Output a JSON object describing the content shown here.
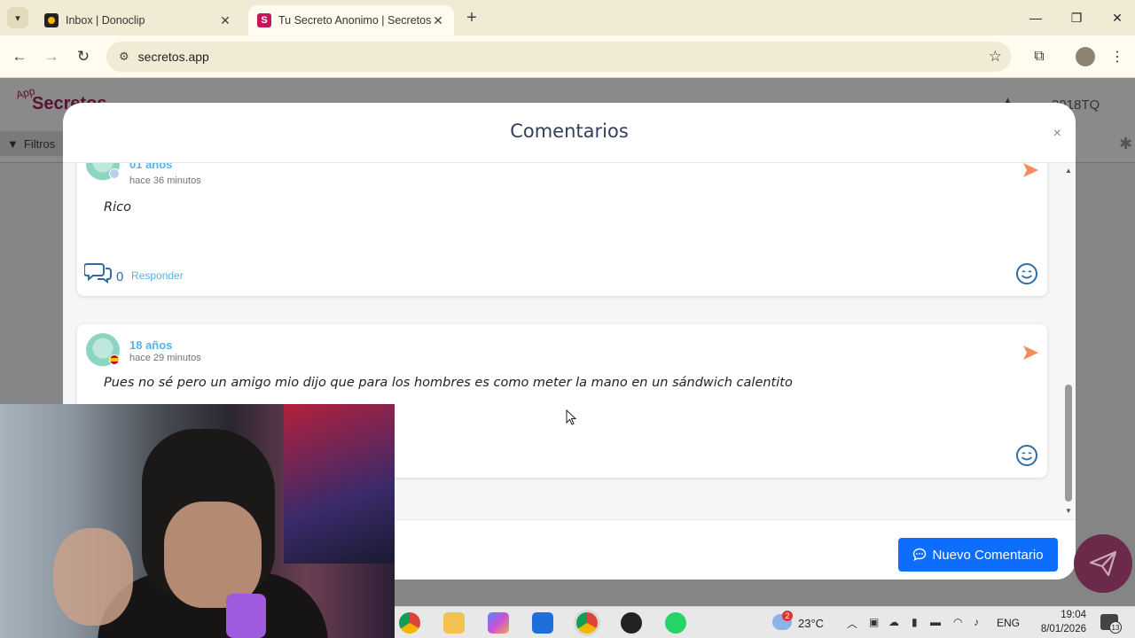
{
  "browser": {
    "tabs": [
      {
        "title": "Inbox | Donoclip",
        "active": false
      },
      {
        "title": "Tu Secreto Anonimo | Secretos",
        "active": true
      }
    ],
    "url": "secretos.app"
  },
  "page": {
    "logo_small": "App",
    "logo": "Secretos",
    "filters_label": "Filtros",
    "user_code": "3918TQ"
  },
  "modal": {
    "title": "Comentarios",
    "close_label": "×",
    "comments": [
      {
        "age": "01 años",
        "time": "hace 36 minutos",
        "text": "Rico",
        "reply_count": "0",
        "reply_label": "Responder"
      },
      {
        "age": "18 años",
        "time": "hace 29 minutos",
        "text": "Pues no sé pero un amigo mio dijo que para los hombres es como meter la mano en un sándwich calentito"
      }
    ],
    "new_comment_label": "Nuevo Comentario"
  },
  "taskbar": {
    "weather_badge": "2",
    "temperature": "23°C",
    "language": "ENG",
    "time": "19:04",
    "date": "8/01/2026",
    "notification_count": "13"
  },
  "colors": {
    "accent_blue": "#0d6efd",
    "age_text": "#52b5e9",
    "report_orange": "#f48b5a",
    "modal_title": "#34405a"
  }
}
